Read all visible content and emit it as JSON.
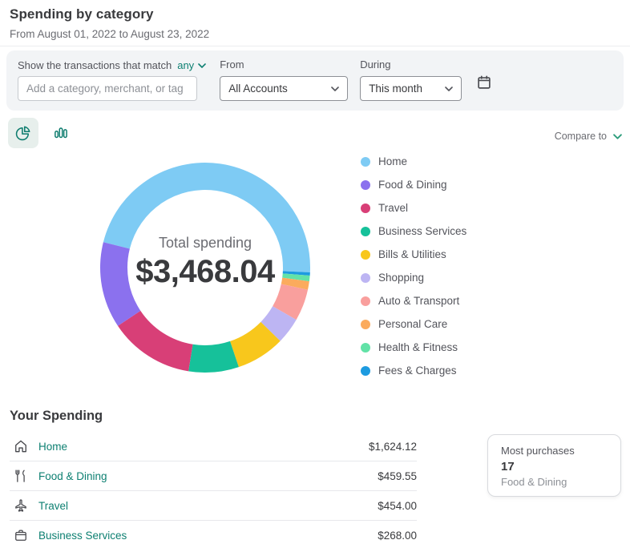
{
  "page": {
    "title": "Spending by category",
    "subtitle": "From August 01, 2022 to August 23, 2022"
  },
  "filters": {
    "match_label": "Show the transactions that match",
    "match_value": "any",
    "match_dropdown_icon": "chevron-down-icon",
    "search_placeholder": "Add a category, merchant, or tag",
    "from_label": "From",
    "from_value": "All Accounts",
    "during_label": "During",
    "during_value": "This month",
    "calendar_icon": "calendar-icon"
  },
  "toolbar": {
    "view_toggles": [
      {
        "icon": "pie-chart-icon",
        "active": true
      },
      {
        "icon": "bar-chart-icon",
        "active": false
      }
    ],
    "compare_label": "Compare to",
    "compare_icon": "chevron-down-icon"
  },
  "chart_data": {
    "type": "pie",
    "title": "Spending by category",
    "center_label": "Total spending",
    "center_value": "$3,468.04",
    "total": 3468.04,
    "start_angle_deg": 284,
    "legend_position": "right",
    "slices": [
      {
        "label": "Home",
        "value": 1624.12,
        "color": "#7ecbf4"
      },
      {
        "label": "Food & Dining",
        "value": 459.55,
        "color": "#8b71ee"
      },
      {
        "label": "Travel",
        "value": 454.0,
        "color": "#d83f77"
      },
      {
        "label": "Business Services",
        "value": 268.0,
        "color": "#16c19a"
      },
      {
        "label": "Bills & Utilities",
        "value": 260.0,
        "color": "#f8c71c"
      },
      {
        "label": "Shopping",
        "value": 140.0,
        "color": "#bdb5f3"
      },
      {
        "label": "Auto & Transport",
        "value": 170.0,
        "color": "#f99f9d"
      },
      {
        "label": "Personal Care",
        "value": 45.0,
        "color": "#fbab5d"
      },
      {
        "label": "Health & Fitness",
        "value": 30.0,
        "color": "#62e2a7"
      },
      {
        "label": "Fees & Charges",
        "value": 17.37,
        "color": "#1d9be0"
      }
    ]
  },
  "spending": {
    "heading": "Your Spending",
    "rows": [
      {
        "icon": "home-icon",
        "label": "Home",
        "value": "$1,624.12"
      },
      {
        "icon": "utensils-icon",
        "label": "Food & Dining",
        "value": "$459.55"
      },
      {
        "icon": "plane-icon",
        "label": "Travel",
        "value": "$454.00"
      },
      {
        "icon": "briefcase-icon",
        "label": "Business Services",
        "value": "$268.00"
      }
    ]
  },
  "insight_card": {
    "title": "Most purchases",
    "count": "17",
    "category": "Food & Dining"
  },
  "colors": {
    "link_teal": "#0e8072",
    "text_dark": "#393a3d",
    "panel_bg": "#f2f4f6"
  }
}
